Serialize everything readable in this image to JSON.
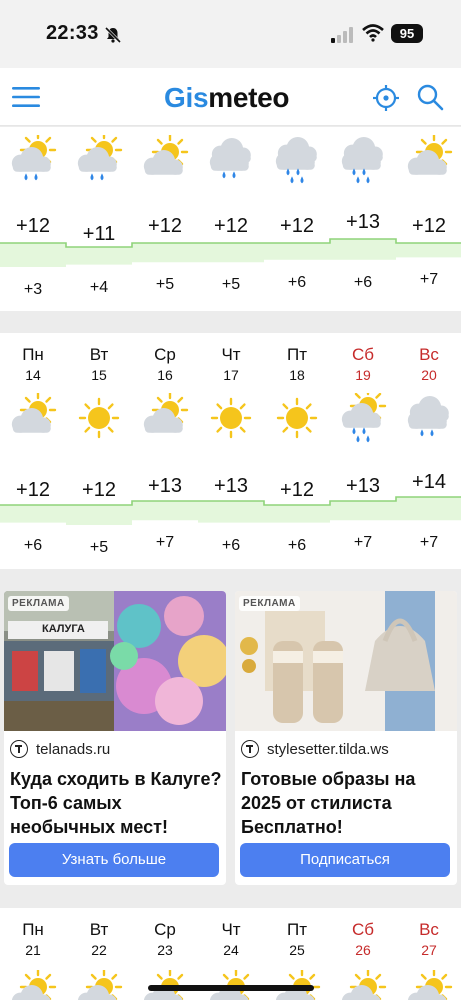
{
  "status_bar": {
    "time": "22:33",
    "battery": "95"
  },
  "header": {
    "logo_part1": "Gis",
    "logo_part2": "meteo"
  },
  "hourly": {
    "icons": [
      "partly-cloudy-light-rain-icon",
      "partly-cloudy-light-rain-icon",
      "partly-cloudy-icon",
      "cloudy-light-rain-icon",
      "cloudy-rain-icon",
      "cloudy-rain-icon",
      "partly-cloudy-icon"
    ],
    "max": [
      "+12",
      "+11",
      "+12",
      "+12",
      "+12",
      "+13",
      "+12"
    ],
    "min": [
      "+3",
      "+4",
      "+5",
      "+5",
      "+6",
      "+6",
      "+7"
    ],
    "max_values": [
      12,
      11,
      12,
      12,
      12,
      13,
      12
    ],
    "min_values": [
      3,
      4,
      5,
      5,
      6,
      6,
      7
    ]
  },
  "week1": {
    "days": [
      {
        "name": "Пн",
        "num": "14",
        "weekend": false,
        "icon": "partly-cloudy-icon",
        "max": "+12",
        "min": "+6",
        "max_v": 12,
        "min_v": 6
      },
      {
        "name": "Вт",
        "num": "15",
        "weekend": false,
        "icon": "sunny-icon",
        "max": "+12",
        "min": "+5",
        "max_v": 12,
        "min_v": 5
      },
      {
        "name": "Ср",
        "num": "16",
        "weekend": false,
        "icon": "partly-cloudy-icon",
        "max": "+13",
        "min": "+7",
        "max_v": 13,
        "min_v": 7
      },
      {
        "name": "Чт",
        "num": "17",
        "weekend": false,
        "icon": "sunny-icon",
        "max": "+13",
        "min": "+6",
        "max_v": 13,
        "min_v": 6
      },
      {
        "name": "Пт",
        "num": "18",
        "weekend": false,
        "icon": "sunny-icon",
        "max": "+12",
        "min": "+6",
        "max_v": 12,
        "min_v": 6
      },
      {
        "name": "Сб",
        "num": "19",
        "weekend": true,
        "icon": "partly-cloudy-rain-icon",
        "max": "+13",
        "min": "+7",
        "max_v": 13,
        "min_v": 7
      },
      {
        "name": "Вс",
        "num": "20",
        "weekend": true,
        "icon": "cloudy-light-rain-icon",
        "max": "+14",
        "min": "+7",
        "max_v": 14,
        "min_v": 7
      }
    ]
  },
  "week2": {
    "days": [
      {
        "name": "Пн",
        "num": "21",
        "weekend": false
      },
      {
        "name": "Вт",
        "num": "22",
        "weekend": false
      },
      {
        "name": "Ср",
        "num": "23",
        "weekend": false
      },
      {
        "name": "Чт",
        "num": "24",
        "weekend": false
      },
      {
        "name": "Пт",
        "num": "25",
        "weekend": false
      },
      {
        "name": "Сб",
        "num": "26",
        "weekend": true
      },
      {
        "name": "Вс",
        "num": "27",
        "weekend": true
      }
    ]
  },
  "ads": [
    {
      "badge": "РЕКЛАМА",
      "sign": "КАЛУГА",
      "domain": "telanads.ru",
      "title": "Куда сходить в Калуге? Топ-6 самых необычных мест!",
      "button": "Узнать больше"
    },
    {
      "badge": "РЕКЛАМА",
      "domain": "stylesetter.tilda.ws",
      "title": "Готовые образы на 2025 от стилиста Бесплатно!",
      "button": "Подписаться"
    }
  ],
  "colors": {
    "accent": "#2a8ae0",
    "weekend": "#c62b2b",
    "band_fill": "#e4f7dc",
    "band_line": "#8fd37a",
    "ad_button": "#4c7ff0",
    "sun": "#f5c51c",
    "cloud": "#d3d8de",
    "rain": "#2f86e6"
  }
}
